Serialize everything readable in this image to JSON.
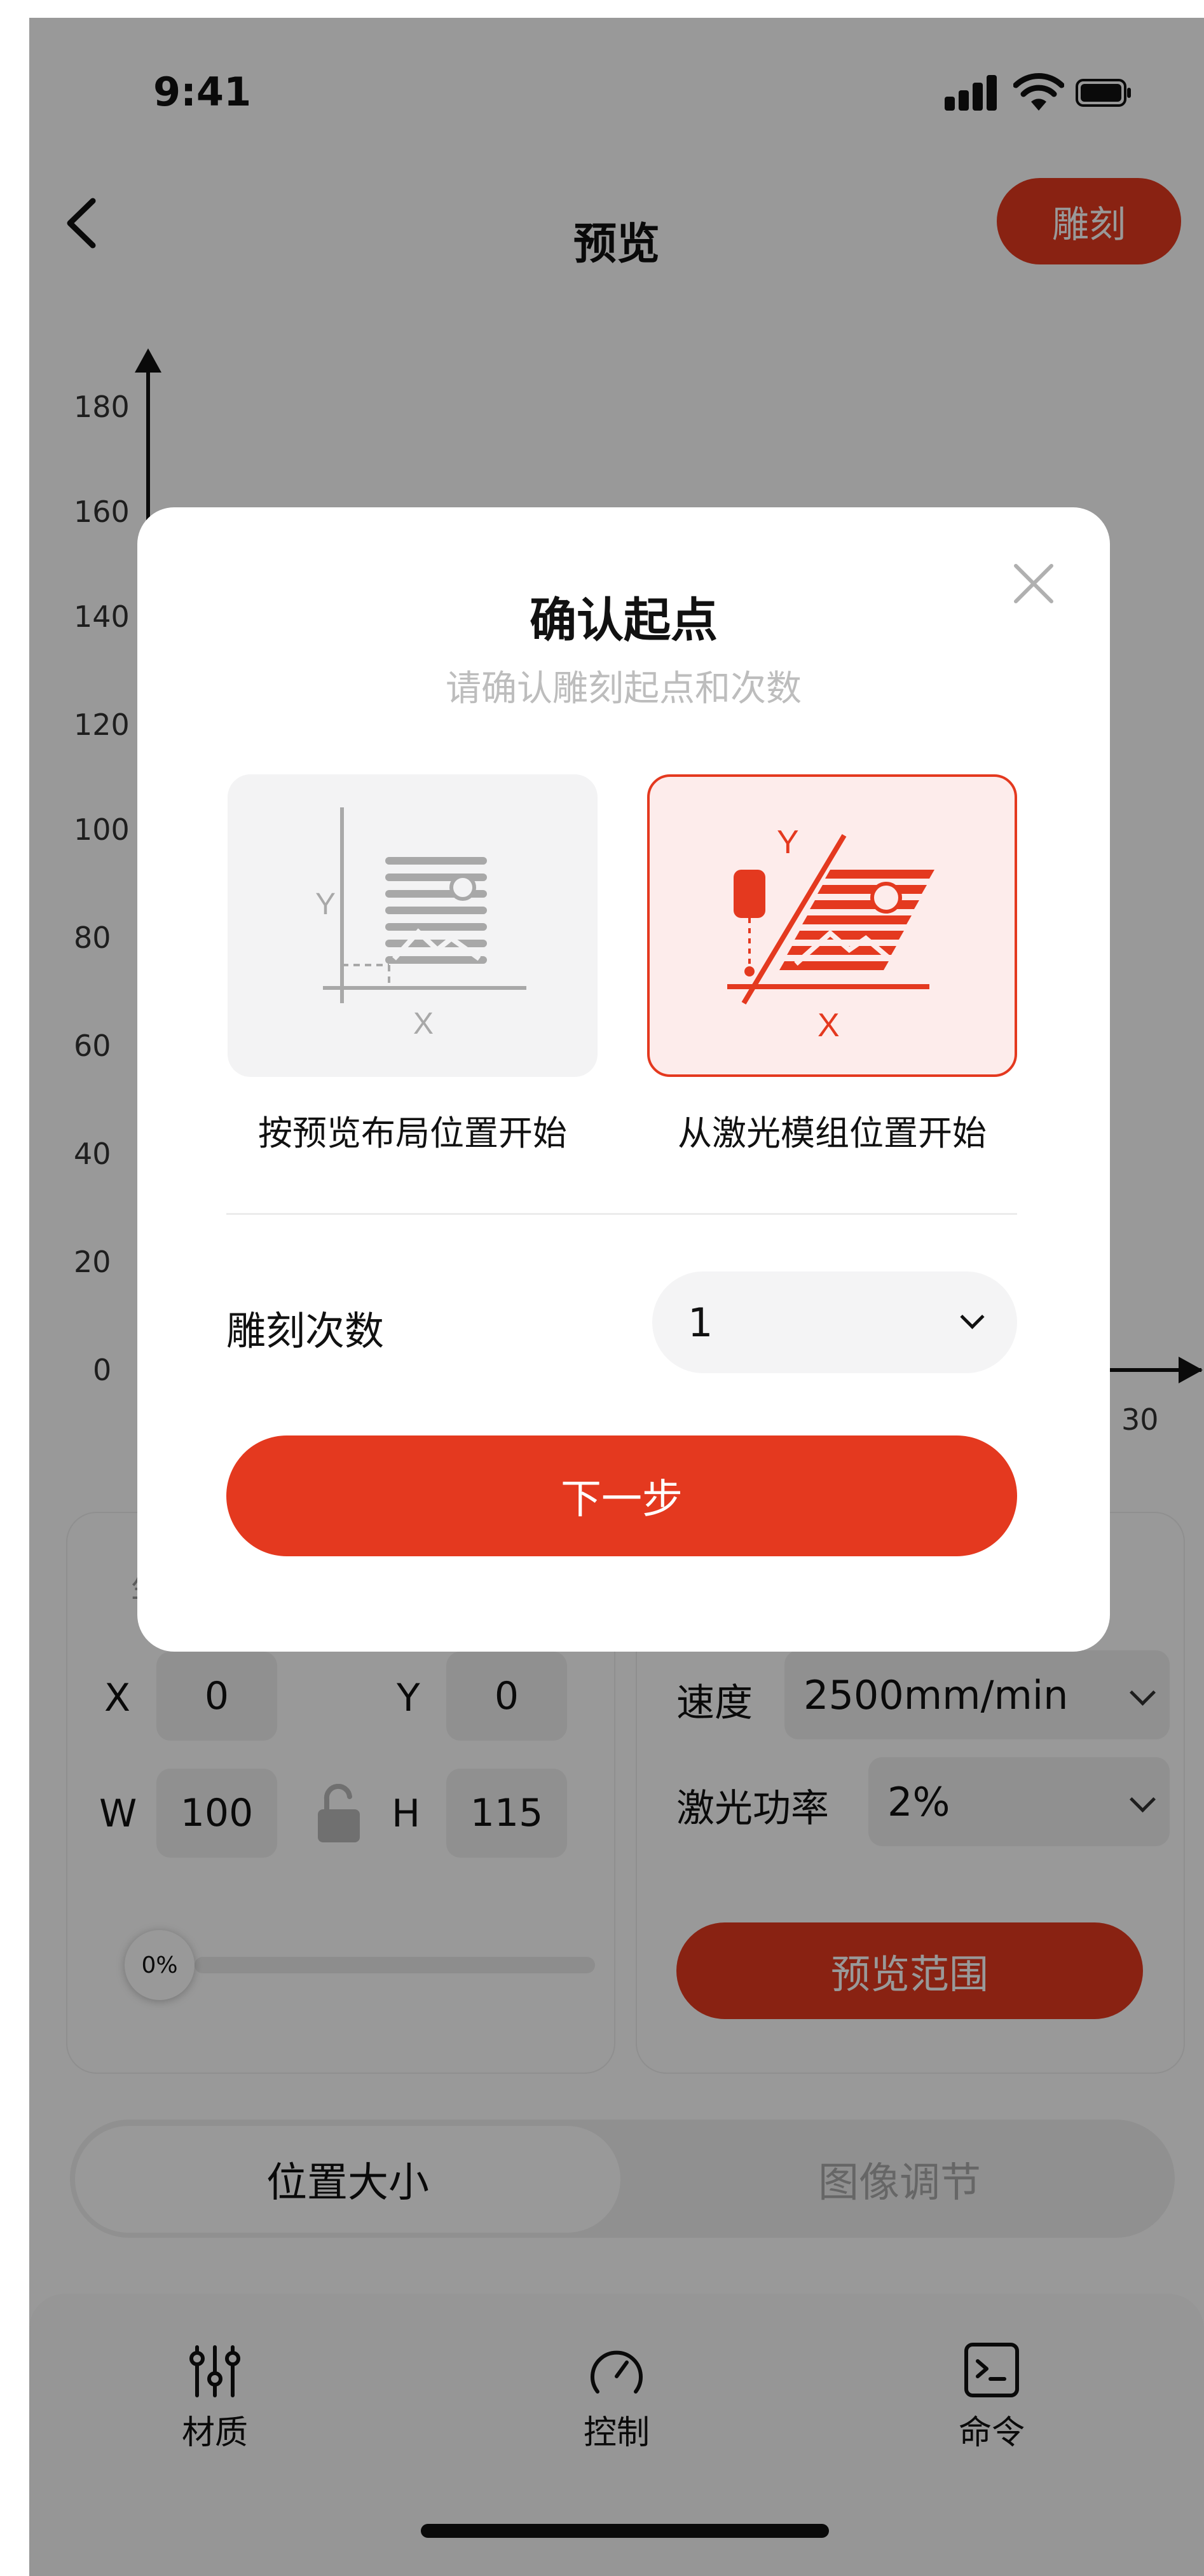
{
  "status_bar": {
    "time": "9:41"
  },
  "nav": {
    "title": "预览",
    "engrave_label": "雕刻"
  },
  "chart": {
    "y_ticks": [
      "180",
      "160",
      "140",
      "120",
      "100",
      "80",
      "60",
      "40",
      "20",
      "0"
    ],
    "x_tick_end": "30"
  },
  "position_card": {
    "section_label": "坐",
    "x_label": "X",
    "x_value": "0",
    "y_label": "Y",
    "y_value": "0",
    "w_label": "W",
    "w_value": "100",
    "h_label": "H",
    "h_value": "115",
    "progress_label": "0%",
    "progress_fraction": 0
  },
  "settings_card": {
    "speed_label": "速度",
    "speed_value": "2500mm/min",
    "power_label": "激光功率",
    "power_value": "2%",
    "preview_range_label": "预览范围"
  },
  "segmented": {
    "active": "位置大小",
    "inactive": "图像调节"
  },
  "tabbar": {
    "items": [
      {
        "label": "材质",
        "icon": "sliders-icon"
      },
      {
        "label": "控制",
        "icon": "gauge-icon"
      },
      {
        "label": "命令",
        "icon": "terminal-icon"
      }
    ]
  },
  "modal": {
    "title": "确认起点",
    "subtitle": "请确认雕刻起点和次数",
    "options": [
      {
        "label": "按预览布局位置开始",
        "x_axis": "X",
        "y_axis": "Y",
        "selected": false
      },
      {
        "label": "从激光模组位置开始",
        "x_axis": "X",
        "y_axis": "Y",
        "selected": true
      }
    ],
    "times_label": "雕刻次数",
    "times_value": "1",
    "next_label": "下一步"
  },
  "colors": {
    "accent": "#e4391f",
    "selected_bg": "#fdeceb",
    "option_bg": "#f3f3f4"
  }
}
